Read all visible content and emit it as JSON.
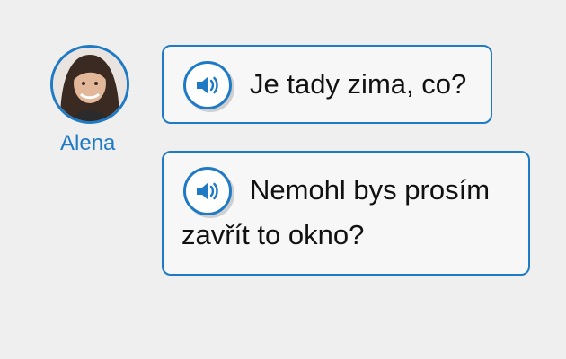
{
  "speaker": {
    "name": "Alena"
  },
  "messages": [
    {
      "text": "Je tady zima, co?",
      "audio_icon": "speaker-icon"
    },
    {
      "text": "Nemohl bys prosím zavřít to okno?",
      "audio_icon": "speaker-icon"
    }
  ],
  "colors": {
    "accent": "#1f7ac6",
    "background": "#efefef",
    "bubble": "#f7f7f7"
  }
}
